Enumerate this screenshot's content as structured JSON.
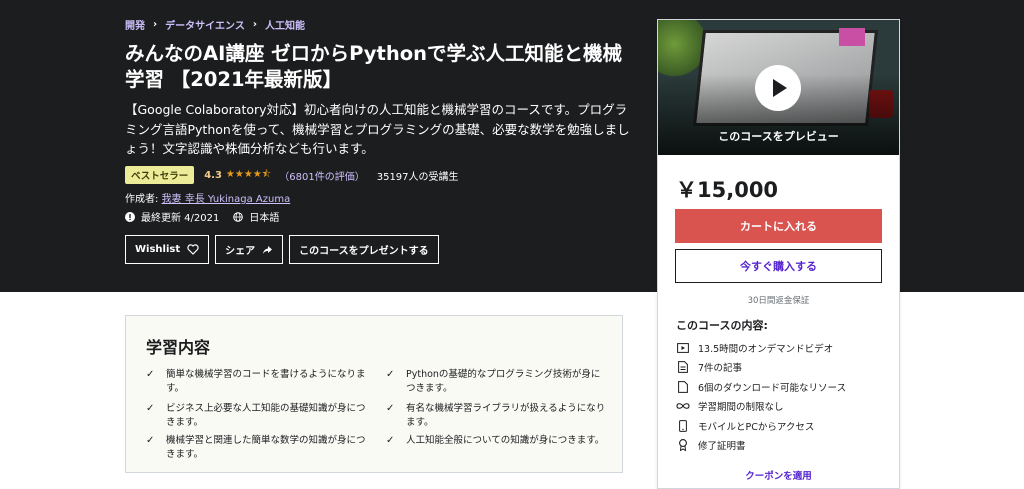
{
  "breadcrumb": [
    "開発",
    "データサイエンス",
    "人工知能"
  ],
  "course": {
    "title": "みんなのAI講座 ゼロからPythonで学ぶ人工知能と機械学習 【2021年最新版】",
    "subtitle": "【Google Colaboratory対応】初心者向けの人工知能と機械学習のコースです。プログラミング言語Pythonを使って、機械学習とプログラミングの基礎、必要な数学を勉強しましょう！文字認識や株価分析なども行います。",
    "badge": "ベストセラー",
    "rating": "4.3",
    "stars": "★★★★⯪",
    "rating_count": "（6801件の評価）",
    "students": "35197人の受講生",
    "author_prefix": "作成者: ",
    "author": "我妻 幸長 Yukinaga Azuma",
    "last_updated": "最終更新 4/2021",
    "language": "日本語"
  },
  "actions": {
    "wishlist": "Wishlist",
    "share": "シェア",
    "gift": "このコースをプレゼントする"
  },
  "sidebar": {
    "preview_label": "このコースをプレビュー",
    "price": "￥15,000",
    "cart": "カートに入れる",
    "buy_now": "今すぐ購入する",
    "guarantee": "30日間返金保証",
    "includes_title": "このコースの内容:",
    "includes": [
      {
        "icon": "video-icon",
        "text": "13.5時間のオンデマンドビデオ"
      },
      {
        "icon": "article-icon",
        "text": "7件の記事"
      },
      {
        "icon": "download-icon",
        "text": "6個のダウンロード可能なリソース"
      },
      {
        "icon": "infinity-icon",
        "text": "学習期間の制限なし"
      },
      {
        "icon": "mobile-icon",
        "text": "モバイルとPCからアクセス"
      },
      {
        "icon": "certificate-icon",
        "text": "修了証明書"
      }
    ],
    "coupon": "クーポンを適用"
  },
  "learn": {
    "title": "学習内容",
    "items": [
      "簡単な機械学習のコードを書けるようになります。",
      "Pythonの基礎的なプログラミング技術が身につきます。",
      "ビジネス上必要な人工知能の基礎知識が身につきます。",
      "有名な機械学習ライブラリが扱えるようになります。",
      "機械学習と関連した簡単な数学の知識が身につきます。",
      "人工知能全般についての知識が身につきます。"
    ]
  },
  "colors": {
    "hero_bg": "#1c1d1f",
    "breadcrumb": "#cec0fc",
    "cart_button": "#d9534f",
    "accent_purple": "#5624d0",
    "badge_bg": "#eceb98",
    "star": "#e59819"
  }
}
